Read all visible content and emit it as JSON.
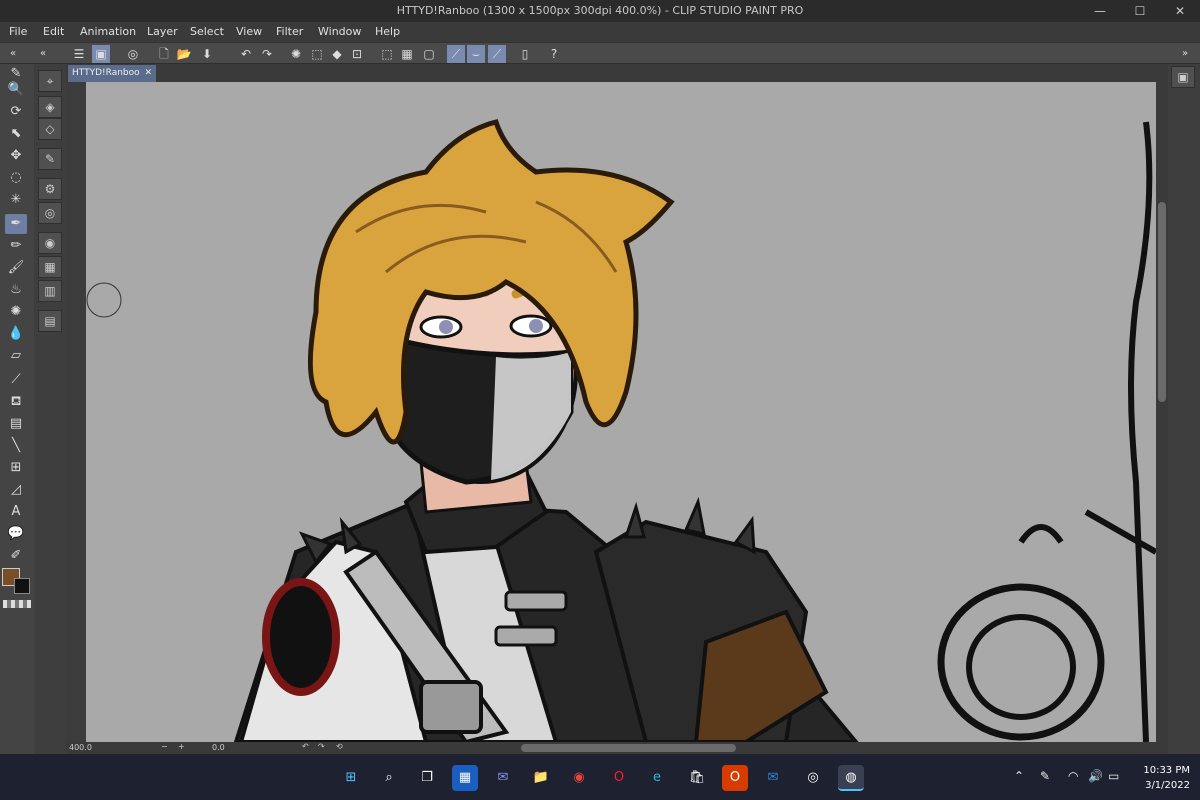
{
  "window": {
    "title": "HTTYD!Ranboo (1300 x 1500px 300dpi 400.0%)  - CLIP STUDIO PAINT PRO",
    "minimize": "—",
    "maximize": "☐",
    "close": "✕"
  },
  "menu": [
    "File",
    "Edit",
    "Animation",
    "Layer",
    "Select",
    "View",
    "Filter",
    "Window",
    "Help"
  ],
  "document_tab": {
    "label": "HTTYD!Ranboo",
    "close": "✕"
  },
  "status": {
    "zoom": "400.0",
    "angle": "0.0"
  },
  "colors": {
    "main": "#7a4f26",
    "sub": "#111111",
    "canvas_bg": "#a9a9a9",
    "accent": "#6f7fa3"
  },
  "taskbar": {
    "time": "10:33 PM",
    "date": "3/1/2022",
    "apps": [
      "windows-start",
      "search",
      "task-view",
      "widgets",
      "teams-chat",
      "file-explorer",
      "chrome",
      "opera",
      "edge",
      "microsoft-store",
      "office",
      "mail",
      "clip-studio-launcher",
      "clip-studio-paint"
    ]
  }
}
